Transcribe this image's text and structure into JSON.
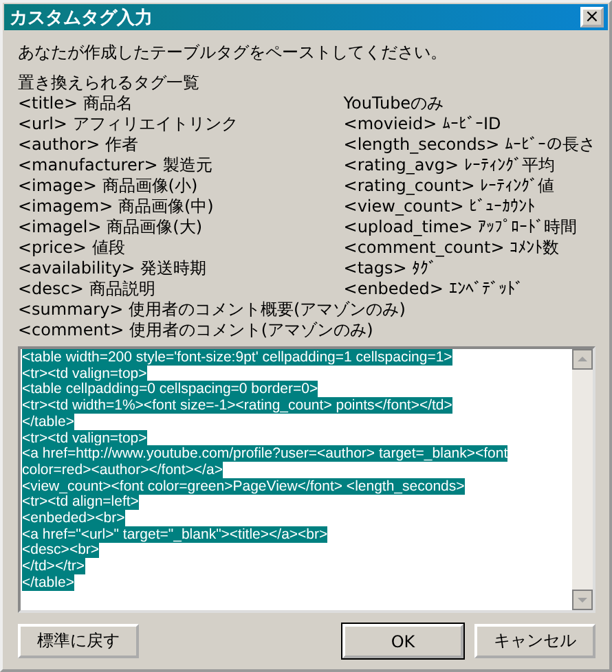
{
  "window": {
    "title": "カスタムタグ入力",
    "close": "×"
  },
  "instruction": "あなたが作成したテーブルタグをペーストしてください。",
  "tag_list": {
    "heading": "置き換えられるタグ一覧",
    "left": [
      "<title> 商品名",
      "<url> アフィリエイトリンク",
      "<author> 作者",
      "<manufacturer> 製造元",
      "<image> 商品画像(小)",
      "<imagem> 商品画像(中)",
      "<imagel> 商品画像(大)",
      "<price> 値段",
      "<availability> 発送時期",
      "<desc> 商品説明"
    ],
    "right": [
      "YouTubeのみ",
      "<movieid> ﾑｰﾋﾞｰID",
      "<length_seconds> ﾑｰﾋﾞｰの長さ",
      "<rating_avg> ﾚｰﾃｨﾝｸﾞ平均",
      "<rating_count> ﾚｰﾃｨﾝｸﾞ値",
      "<view_count> ﾋﾞｭｰｶｳﾝﾄ",
      "<upload_time> ｱｯﾌﾟﾛｰﾄﾞ時間",
      "<comment_count> ｺﾒﾝﾄ数",
      "<tags> ﾀｸﾞ",
      "<enbeded> ｴﾝﾍﾞﾃﾞｯﾄﾞ"
    ],
    "full": [
      "<summary> 使用者のコメント概要(アマゾンのみ)",
      "<comment> 使用者のコメント(アマゾンのみ)"
    ]
  },
  "editor": {
    "selected": true,
    "lines": [
      "<table width=200 style='font-size:9pt' cellpadding=1 cellspacing=1>",
      "<tr><td valign=top>",
      "<table cellpadding=0 cellspacing=0 border=0>",
      "<tr><td width=1%><font size=-1><rating_count> points</font></td>",
      "</table>",
      "<tr><td valign=top>",
      "<a href=http://www.youtube.com/profile?user=<author> target=_blank><font",
      "color=red><author></font></a>",
      "<view_count><font color=green>PageView</font> <length_seconds>",
      "<tr><td align=left>",
      "<enbeded><br>",
      "<a href=\"<url>\" target=\"_blank\"><title></a><br>",
      "<desc><br>",
      "</td></tr>",
      "</table>"
    ]
  },
  "buttons": {
    "reset": "標準に戻す",
    "ok": "OK",
    "cancel": "キャンセル"
  }
}
